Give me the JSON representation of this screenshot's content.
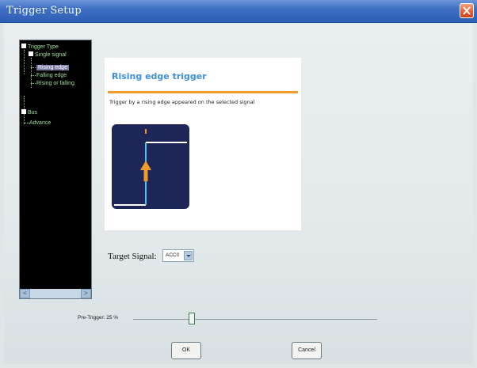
{
  "window": {
    "title": "Trigger Setup"
  },
  "tree": {
    "items": [
      {
        "label": "Trigger Type"
      },
      {
        "label": "Single signal"
      },
      {
        "label": "Rising edge"
      },
      {
        "label": "Falling edge"
      },
      {
        "label": "Rising or falling"
      },
      {
        "label": "Bus"
      },
      {
        "label": "Advance"
      }
    ],
    "scroll_left": "<",
    "scroll_right": ">"
  },
  "description": {
    "title": "Rising edge trigger",
    "text": "Trigger by a rising edge appeared on the selected signal"
  },
  "signal": {
    "label": "Target Signal:",
    "selected": "ACC0"
  },
  "pretrigger": {
    "label": "Pre-Trigger: 25 %",
    "value_percent": 25
  },
  "buttons": {
    "ok": "OK",
    "cancel": "Cancel"
  },
  "colors": {
    "title_bar": "#3f6fc3",
    "tree_bg": "#000000",
    "tree_text": "#9fe29a",
    "accent_orange": "#f09a2a",
    "title_blue": "#3f8fd6",
    "waveform_bg": "#1d2656"
  }
}
